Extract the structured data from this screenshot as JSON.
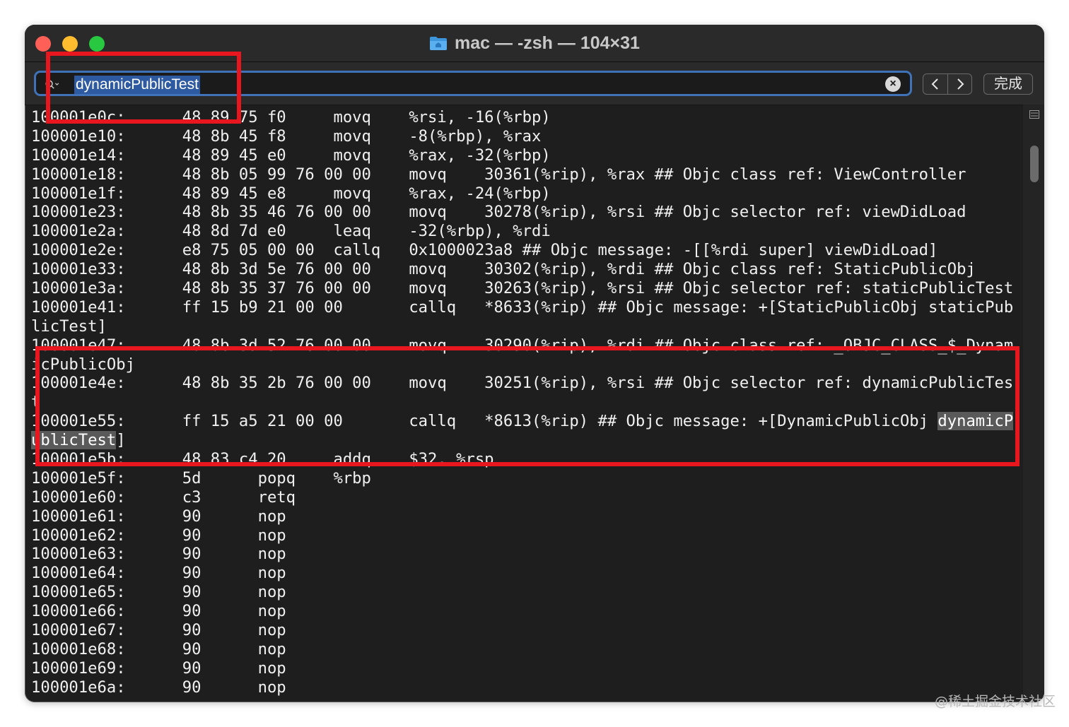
{
  "window": {
    "title": "mac — -zsh — 104×31"
  },
  "find": {
    "query": "dynamicPublicTest",
    "done_label": "完成"
  },
  "terminal": {
    "lines": [
      [
        {
          "t": "100001e0c:      48 89 75 f0     movq    %rsi, -16(%rbp)"
        }
      ],
      [
        {
          "t": "100001e10:      48 8b 45 f8     movq    -8(%rbp), %rax"
        }
      ],
      [
        {
          "t": "100001e14:      48 89 45 e0     movq    %rax, -32(%rbp)"
        }
      ],
      [
        {
          "t": "100001e18:      48 8b 05 99 76 00 00    movq    30361(%rip), %rax ## Objc class ref: ViewController"
        }
      ],
      [
        {
          "t": "100001e1f:      48 89 45 e8     movq    %rax, -24(%rbp)"
        }
      ],
      [
        {
          "t": "100001e23:      48 8b 35 46 76 00 00    movq    30278(%rip), %rsi ## Objc selector ref: viewDidLoad"
        }
      ],
      [
        {
          "t": "100001e2a:      48 8d 7d e0     leaq    -32(%rbp), %rdi"
        }
      ],
      [
        {
          "t": "100001e2e:      e8 75 05 00 00  callq   0x1000023a8 ## Objc message: -[[%rdi super] viewDidLoad]"
        }
      ],
      [
        {
          "t": "100001e33:      48 8b 3d 5e 76 00 00    movq    30302(%rip), %rdi ## Objc class ref: StaticPublicObj"
        }
      ],
      [
        {
          "t": "100001e3a:      48 8b 35 37 76 00 00    movq    30263(%rip), %rsi ## Objc selector ref: staticPublicTest"
        }
      ],
      [
        {
          "t": "100001e41:      ff 15 b9 21 00 00       callq   *8633(%rip) ## Objc message: +[StaticPublicObj staticPub"
        }
      ],
      [
        {
          "t": "licTest]"
        }
      ],
      [
        {
          "t": "100001e47:      48 8b 3d 52 76 00 00    movq    30290(%rip), %rdi ## Objc class ref: _OBJC_CLASS_$_Dynam"
        }
      ],
      [
        {
          "t": "icPublicObj"
        }
      ],
      [
        {
          "t": "100001e4e:      48 8b 35 2b 76 00 00    movq    30251(%rip), %rsi ## Objc selector ref: dynamicPublicTes"
        }
      ],
      [
        {
          "t": "t"
        }
      ],
      [
        {
          "t": "100001e55:      ff 15 a5 21 00 00       callq   *8613(%rip) ## Objc message: +[DynamicPublicObj "
        },
        {
          "t": "dynamicP",
          "hl": true
        }
      ],
      [
        {
          "t": "ublicTest",
          "hl": true
        },
        {
          "t": "]"
        }
      ],
      [
        {
          "t": "100001e5b:      48 83 c4 20     addq    $32, %rsp"
        }
      ],
      [
        {
          "t": "100001e5f:      5d      popq    %rbp"
        }
      ],
      [
        {
          "t": "100001e60:      c3      retq"
        }
      ],
      [
        {
          "t": "100001e61:      90      nop"
        }
      ],
      [
        {
          "t": "100001e62:      90      nop"
        }
      ],
      [
        {
          "t": "100001e63:      90      nop"
        }
      ],
      [
        {
          "t": "100001e64:      90      nop"
        }
      ],
      [
        {
          "t": "100001e65:      90      nop"
        }
      ],
      [
        {
          "t": "100001e66:      90      nop"
        }
      ],
      [
        {
          "t": "100001e67:      90      nop"
        }
      ],
      [
        {
          "t": "100001e68:      90      nop"
        }
      ],
      [
        {
          "t": "100001e69:      90      nop"
        }
      ],
      [
        {
          "t": "100001e6a:      90      nop"
        }
      ]
    ]
  },
  "watermark": "@稀土掘金技术社区",
  "colors": {
    "annotation": "#e8161e",
    "search_focus": "#3f72b8"
  }
}
